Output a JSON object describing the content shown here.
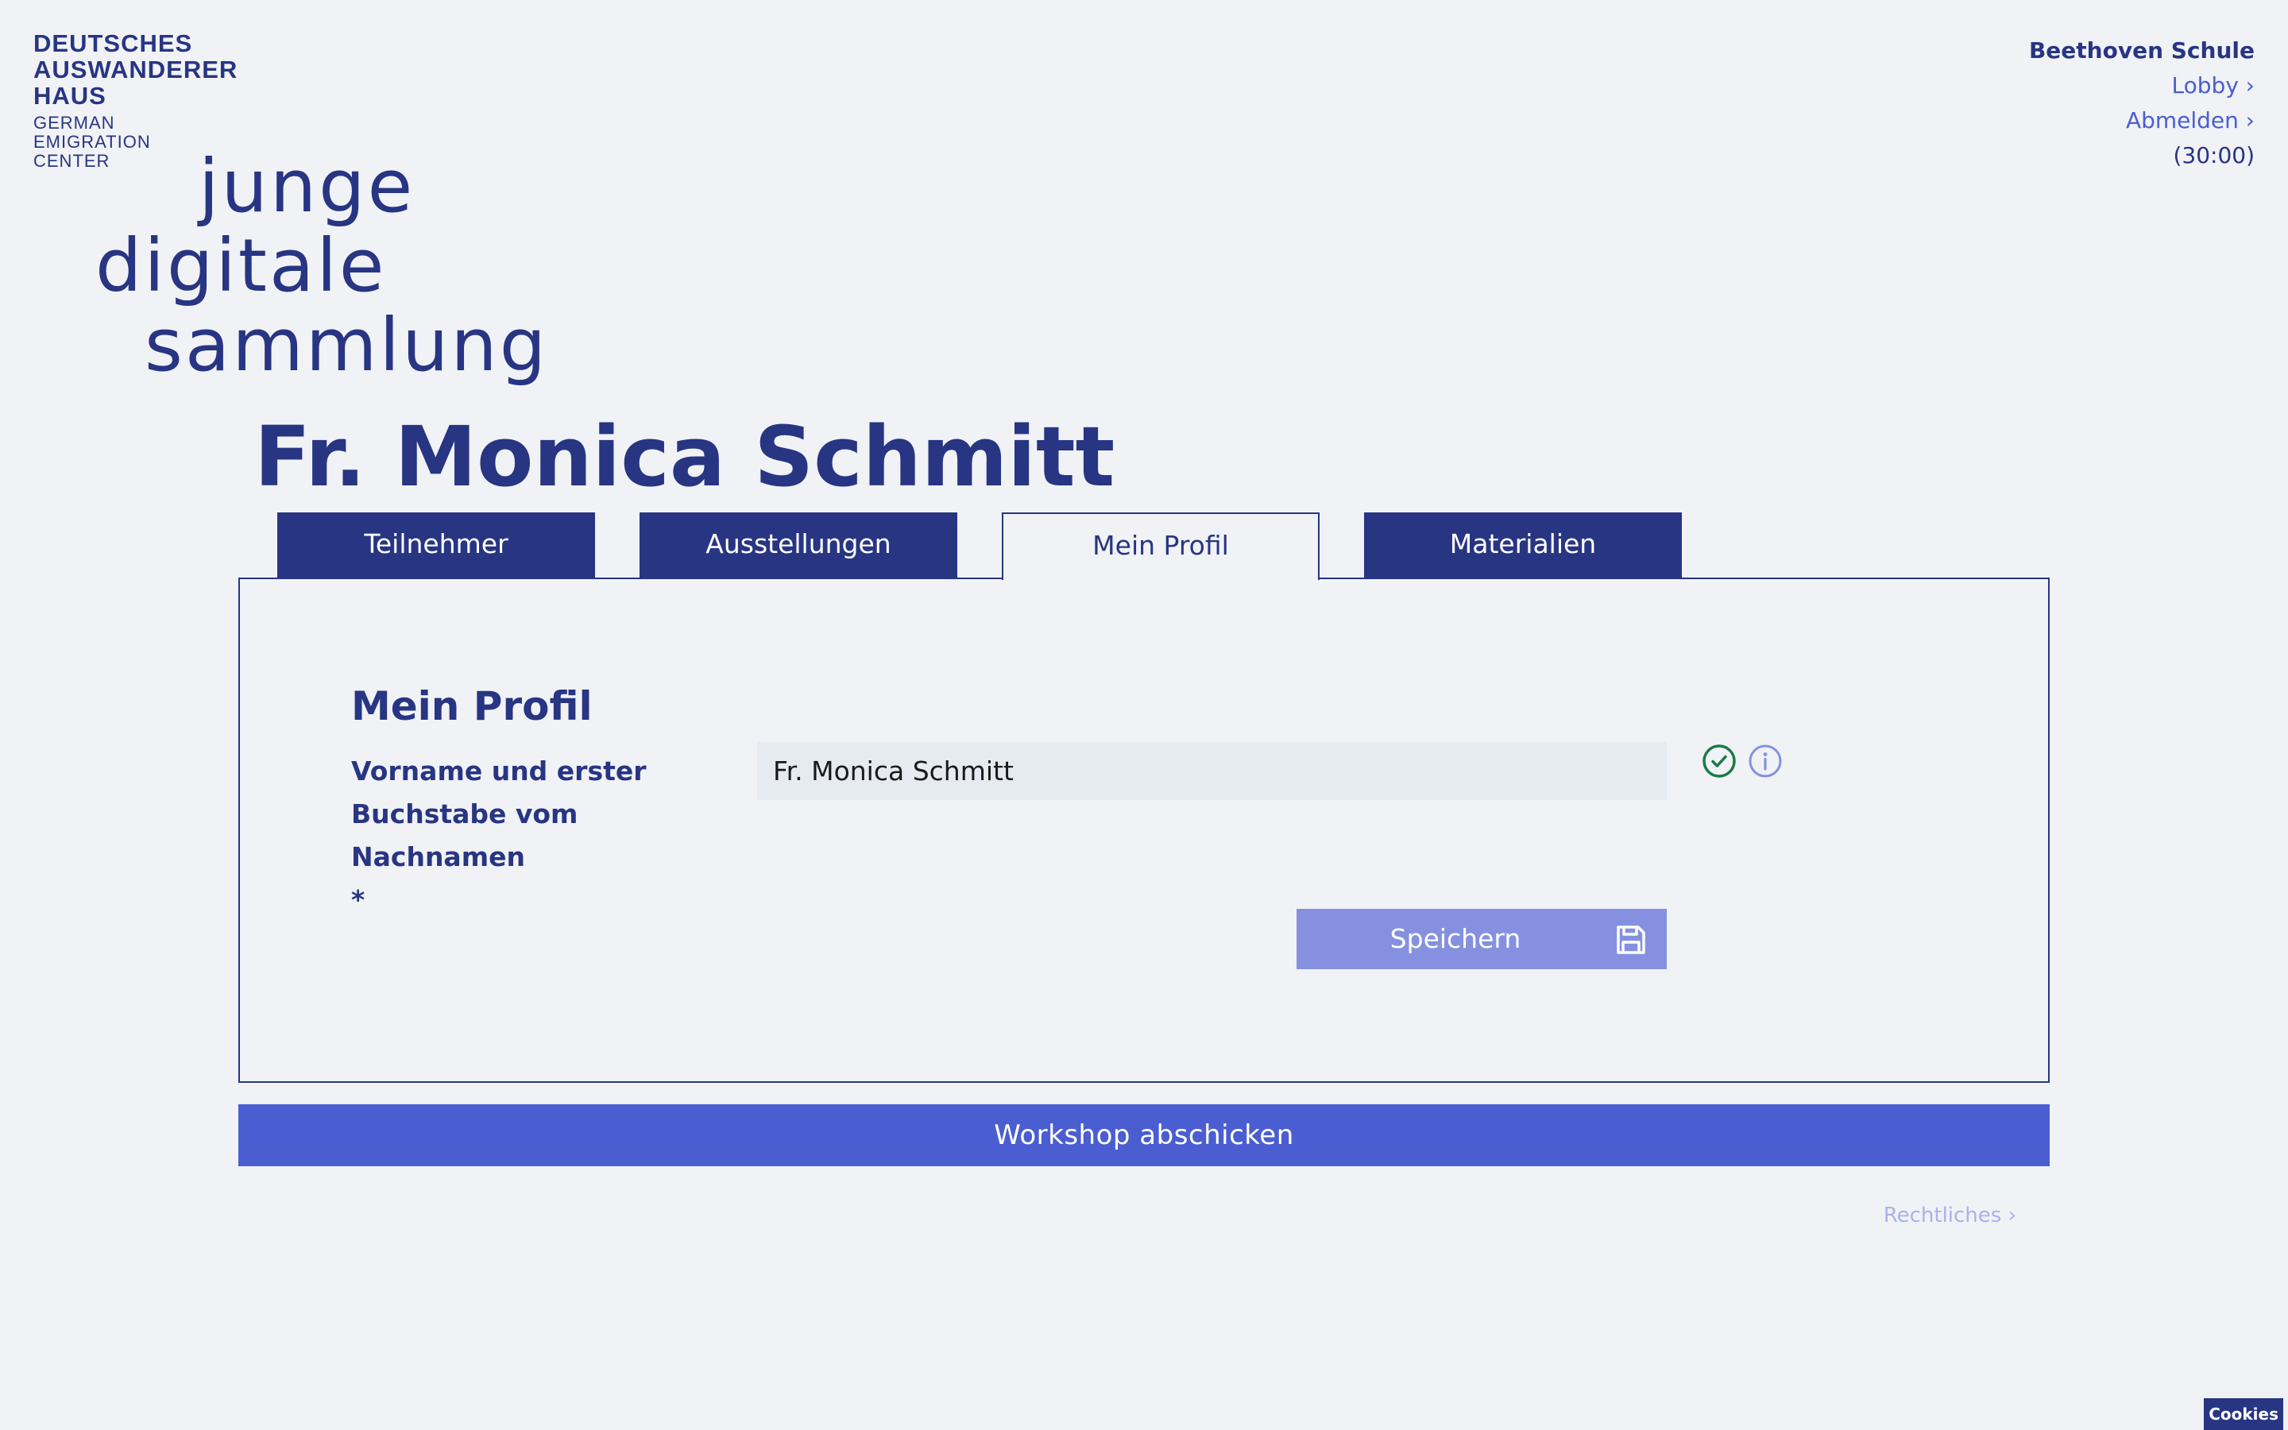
{
  "brand": {
    "name_lines": [
      "DEUTSCHES",
      "AUSWANDERER",
      "HAUS"
    ],
    "sub_lines": [
      "GERMAN",
      "EMIGRATION",
      "CENTER"
    ]
  },
  "wordmark": {
    "lines": [
      "junge",
      "digitale",
      "sammlung"
    ]
  },
  "header": {
    "school": "Beethoven Schule",
    "lobby_link": "Lobby ›",
    "logout_link": "Abmelden ›",
    "timer": "(30:00)"
  },
  "page_title": "Fr. Monica Schmitt",
  "tabs": [
    {
      "label": "Teilnehmer",
      "active": false
    },
    {
      "label": "Ausstellungen",
      "active": false
    },
    {
      "label": "Mein Profil",
      "active": true
    },
    {
      "label": "Materialien",
      "active": false
    }
  ],
  "profile": {
    "section_title": "Mein Profil",
    "name_label_lines": [
      "Vorname und erster",
      "Buchstabe vom Nachnamen",
      "*"
    ],
    "name_value": "Fr. Monica Schmitt",
    "save_label": "Speichern"
  },
  "submit_label": "Workshop abschicken",
  "legal_link": "Rechtliches ›",
  "cookies_label": "Cookies",
  "colors": {
    "primary": "#283583",
    "accent": "#4a5ed1",
    "save_button": "#8591e0",
    "success": "#1a7a4a",
    "background": "#f0f2f5"
  },
  "icons": {
    "valid": "check-circle-icon",
    "info": "info-circle-icon",
    "save": "floppy-disk-icon"
  }
}
